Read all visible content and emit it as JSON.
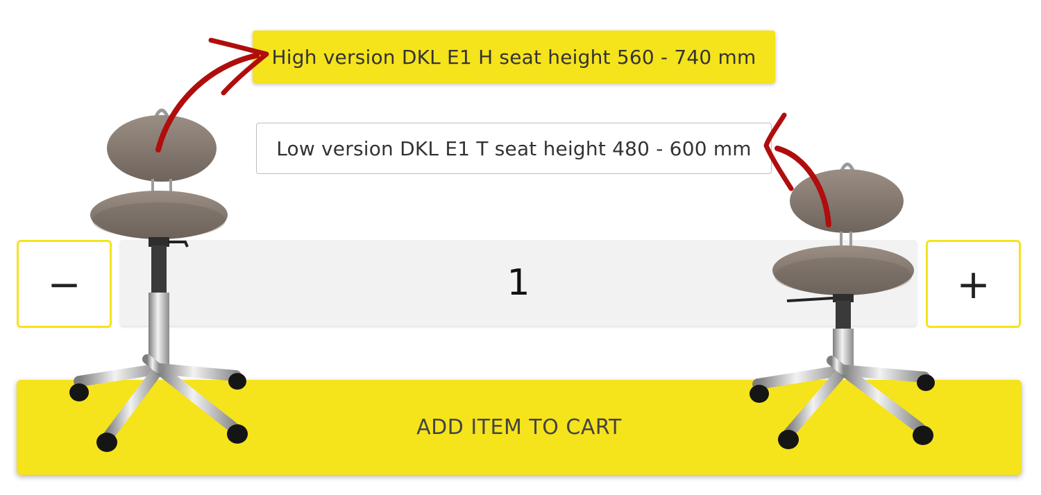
{
  "variants": {
    "high_label": "High version DKL E1 H seat height 560 - 740 mm",
    "low_label": "Low version DKL E1 T seat height 480 - 600 mm"
  },
  "quantity": {
    "minus_label": "−",
    "value": "1",
    "plus_label": "+"
  },
  "cart": {
    "add_label": "ADD ITEM TO CART"
  },
  "colors": {
    "accent_yellow": "#f5e31c",
    "arrow_red": "#b00d0d",
    "chair_upholstery": "#8a7d73"
  },
  "icons": {
    "left_product": "stool-chair-image",
    "right_product": "stool-chair-image",
    "annotation": "red-arrow"
  }
}
